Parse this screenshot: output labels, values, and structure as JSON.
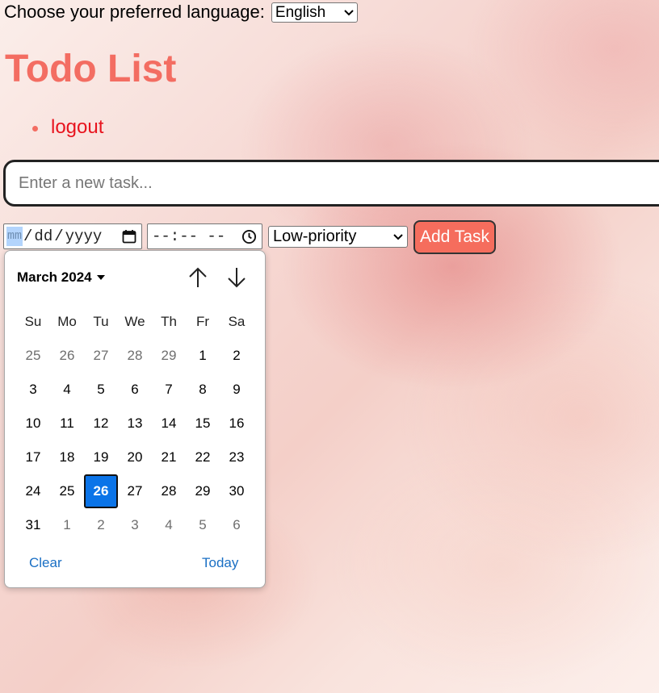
{
  "language": {
    "label": "Choose your preferred language:",
    "selected": "English"
  },
  "page": {
    "title": "Todo List",
    "links": [
      "logout"
    ]
  },
  "task_form": {
    "placeholder": "Enter a new task...",
    "date_placeholder": {
      "mm": "mm",
      "sep1": "/",
      "dd": "dd",
      "sep2": "/",
      "yyyy": "yyyy"
    },
    "time_placeholder": "--:-- --",
    "priority_selected": "Low-priority",
    "add_label": "Add Task"
  },
  "date_picker": {
    "month_label": "March 2024",
    "weekdays": [
      "Su",
      "Mo",
      "Tu",
      "We",
      "Th",
      "Fr",
      "Sa"
    ],
    "weeks": [
      [
        {
          "d": "25",
          "o": true
        },
        {
          "d": "26",
          "o": true
        },
        {
          "d": "27",
          "o": true
        },
        {
          "d": "28",
          "o": true
        },
        {
          "d": "29",
          "o": true
        },
        {
          "d": "1"
        },
        {
          "d": "2"
        }
      ],
      [
        {
          "d": "3"
        },
        {
          "d": "4"
        },
        {
          "d": "5"
        },
        {
          "d": "6"
        },
        {
          "d": "7"
        },
        {
          "d": "8"
        },
        {
          "d": "9"
        }
      ],
      [
        {
          "d": "10"
        },
        {
          "d": "11"
        },
        {
          "d": "12"
        },
        {
          "d": "13"
        },
        {
          "d": "14"
        },
        {
          "d": "15"
        },
        {
          "d": "16"
        }
      ],
      [
        {
          "d": "17"
        },
        {
          "d": "18"
        },
        {
          "d": "19"
        },
        {
          "d": "20"
        },
        {
          "d": "21"
        },
        {
          "d": "22"
        },
        {
          "d": "23"
        }
      ],
      [
        {
          "d": "24"
        },
        {
          "d": "25"
        },
        {
          "d": "26",
          "s": true
        },
        {
          "d": "27"
        },
        {
          "d": "28"
        },
        {
          "d": "29"
        },
        {
          "d": "30"
        }
      ],
      [
        {
          "d": "31"
        },
        {
          "d": "1",
          "o": true
        },
        {
          "d": "2",
          "o": true
        },
        {
          "d": "3",
          "o": true
        },
        {
          "d": "4",
          "o": true
        },
        {
          "d": "5",
          "o": true
        },
        {
          "d": "6",
          "o": true
        }
      ]
    ],
    "clear_label": "Clear",
    "today_label": "Today"
  },
  "colors": {
    "title": "#f36d62",
    "link": "#e8141e",
    "add_button": "#f56d5d",
    "selected_day": "#0b74e8"
  }
}
